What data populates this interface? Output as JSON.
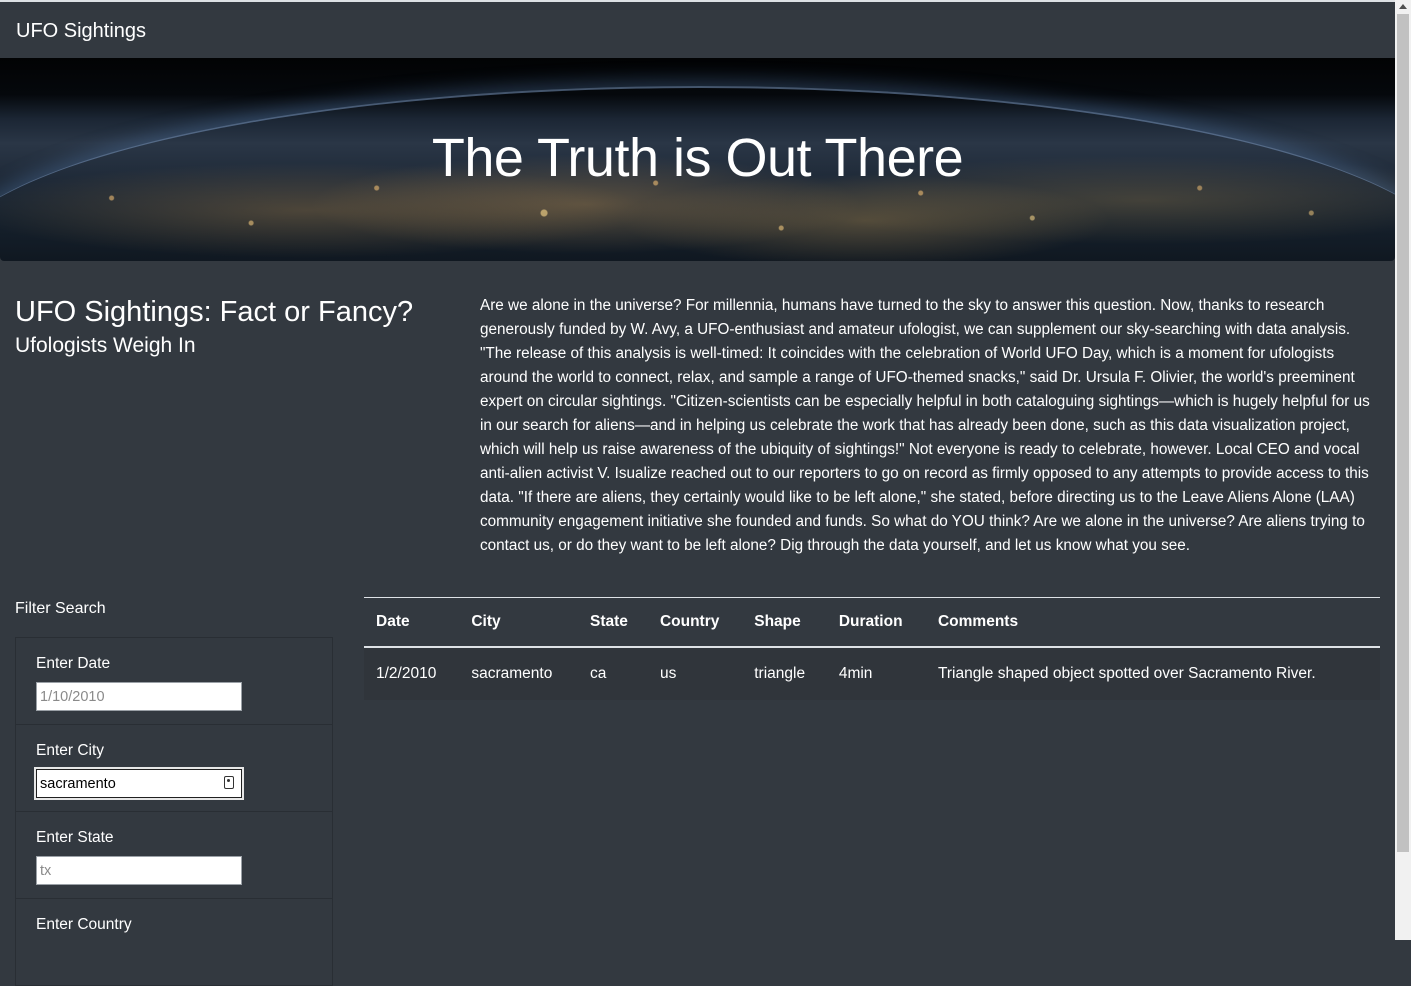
{
  "navbar": {
    "brand": "UFO Sightings"
  },
  "hero": {
    "title": "The Truth is Out There"
  },
  "article": {
    "title": "UFO Sightings: Fact or Fancy?",
    "subtitle": "Ufologists Weigh In",
    "body": "Are we alone in the universe? For millennia, humans have turned to the sky to answer this question. Now, thanks to research generously funded by W. Avy, a UFO-enthusiast and amateur ufologist, we can supplement our sky-searching with data analysis. \"The release of this analysis is well-timed: It coincides with the celebration of World UFO Day, which is a moment for ufologists around the world to connect, relax, and sample a range of UFO-themed snacks,\" said Dr. Ursula F. Olivier, the world's preeminent expert on circular sightings. \"Citizen-scientists can be especially helpful in both cataloguing sightings—which is hugely helpful for us in our search for aliens—and in helping us celebrate the work that has already been done, such as this data visualization project, which will help us raise awareness of the ubiquity of sightings!\" Not everyone is ready to celebrate, however. Local CEO and vocal anti-alien activist V. Isualize reached out to our reporters to go on record as firmly opposed to any attempts to provide access to this data. \"If there are aliens, they certainly would like to be left alone,\" she stated, before directing us to the Leave Aliens Alone (LAA) community engagement initiative she founded and funds. So what do YOU think? Are we alone in the universe? Are aliens trying to contact us, or do they want to be left alone? Dig through the data yourself, and let us know what you see."
  },
  "filters": {
    "heading": "Filter Search",
    "items": [
      {
        "label": "Enter Date",
        "placeholder": "1/10/2010",
        "value": ""
      },
      {
        "label": "Enter City",
        "placeholder": "",
        "value": "sacramento"
      },
      {
        "label": "Enter State",
        "placeholder": "tx",
        "value": ""
      },
      {
        "label": "Enter Country",
        "placeholder": "",
        "value": ""
      }
    ]
  },
  "table": {
    "headers": [
      "Date",
      "City",
      "State",
      "Country",
      "Shape",
      "Duration",
      "Comments"
    ],
    "rows": [
      [
        "1/2/2010",
        "sacramento",
        "ca",
        "us",
        "triangle",
        "4min",
        "Triangle shaped object spotted over Sacramento River."
      ]
    ]
  },
  "colors": {
    "background": "#333940",
    "text": "#ffffff",
    "border": "#dee2e6"
  }
}
